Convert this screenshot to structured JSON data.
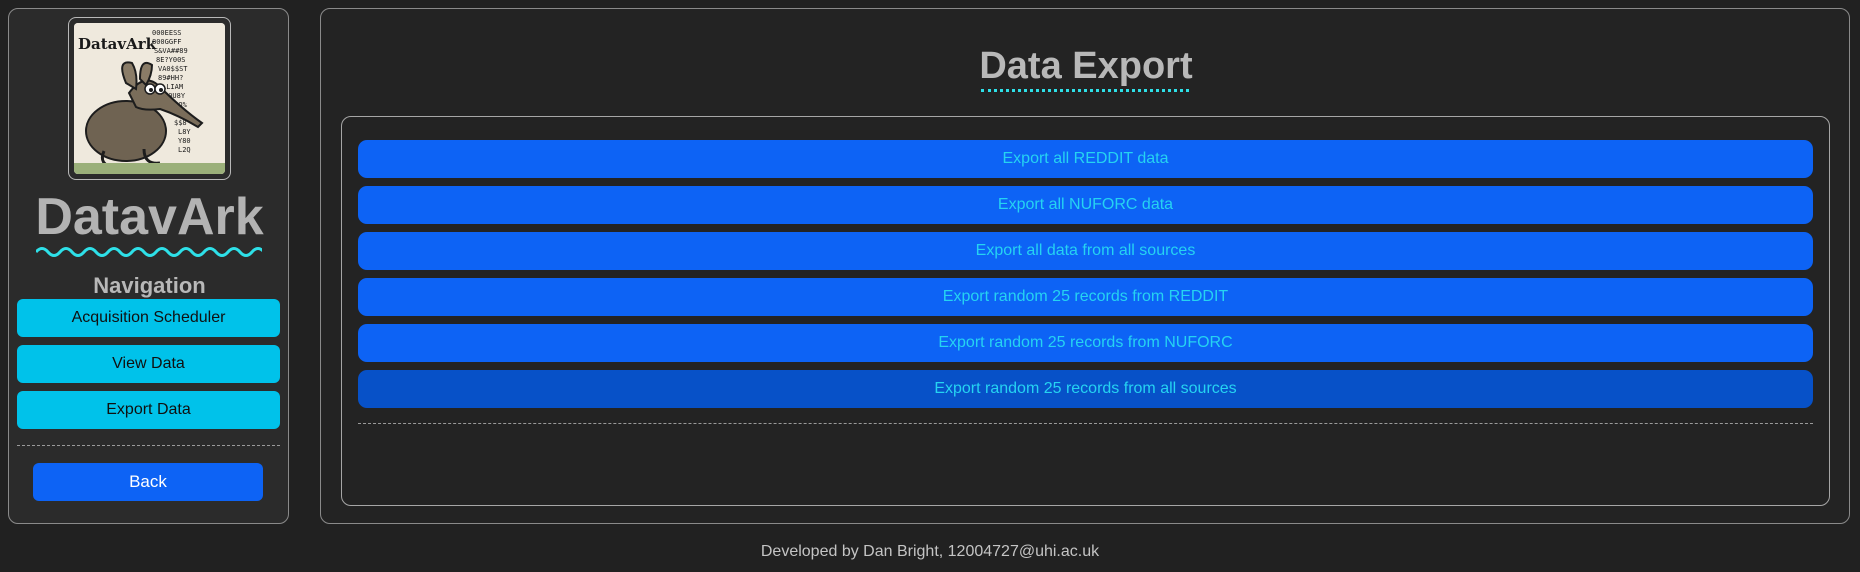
{
  "sidebar": {
    "logo": {
      "text": "DatavArk",
      "icon": "aardvark-logo"
    },
    "brand": "DatavArk",
    "nav_heading": "Navigation",
    "nav_items": [
      {
        "label": "Acquisition Scheduler"
      },
      {
        "label": "View Data"
      },
      {
        "label": "Export Data"
      }
    ],
    "back_label": "Back"
  },
  "main": {
    "title": "Data Export",
    "export_buttons": [
      {
        "label": "Export all REDDIT data"
      },
      {
        "label": "Export all NUFORC data"
      },
      {
        "label": "Export all data from all sources"
      },
      {
        "label": "Export random 25 records from REDDIT"
      },
      {
        "label": "Export random 25 records from NUFORC"
      },
      {
        "label": "Export random 25 records from all sources"
      }
    ]
  },
  "footer": {
    "credit": "Developed by Dan Bright, 12004727@uhi.ac.uk"
  },
  "colors": {
    "background": "#212121",
    "nav_button": "#00c2ea",
    "primary_button": "#0d63f5",
    "export_text": "#25d3f2",
    "accent_underline": "#2ee0e8"
  }
}
